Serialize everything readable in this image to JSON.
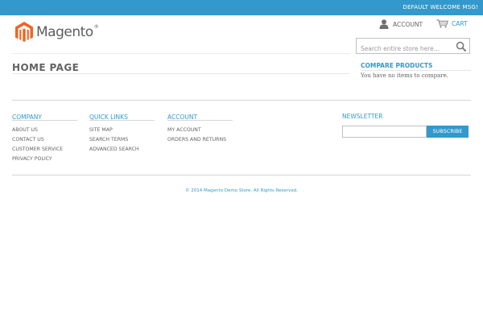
{
  "colors": {
    "accent": "#3399cc",
    "text": "#636363",
    "logo_orange": "#f26322"
  },
  "header": {
    "welcome": "DEFAULT WELCOME MSG!",
    "logo_text": "Magento",
    "logo_reg": "®",
    "account_label": "ACCOUNT",
    "account_icon": "person-icon",
    "cart_label": "CART",
    "cart_icon": "cart-icon",
    "search_placeholder": "Search entire store here...",
    "search_icon": "search-icon"
  },
  "main": {
    "title": "HOME PAGE"
  },
  "compare": {
    "title": "COMPARE PRODUCTS",
    "empty_text": "You have no items to compare."
  },
  "footer": {
    "columns": [
      {
        "heading": "COMPANY",
        "links": [
          "ABOUT US",
          "CONTACT US",
          "CUSTOMER SERVICE",
          "PRIVACY POLICY"
        ]
      },
      {
        "heading": "QUICK LINKS",
        "links": [
          "SITE MAP",
          "SEARCH TERMS",
          "ADVANCED SEARCH"
        ]
      },
      {
        "heading": "ACCOUNT",
        "links": [
          "MY ACCOUNT",
          "ORDERS AND RETURNS"
        ]
      }
    ],
    "newsletter": {
      "heading": "NEWSLETTER",
      "button": "SUBSCRIBE"
    },
    "copyright": "© 2014 Magento Demo Store. All Rights Reserved."
  }
}
